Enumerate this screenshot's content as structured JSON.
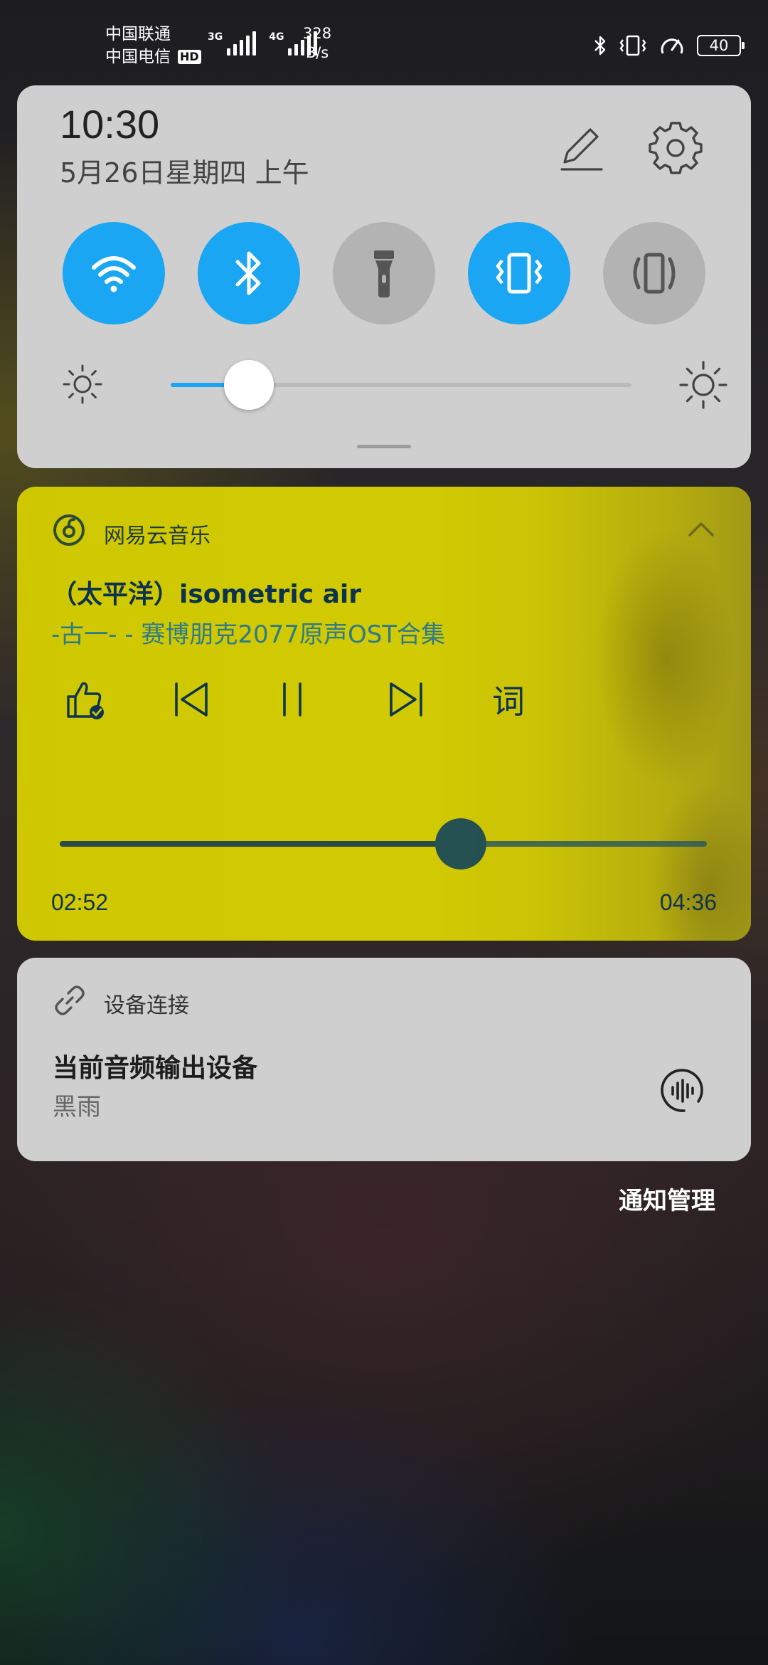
{
  "status_bar": {
    "carrier_1": "中国联通",
    "carrier_2": "中国电信",
    "hd_badge": "HD",
    "sim1_network": "3G",
    "sim2_network": "4G",
    "net_speed_value": "328",
    "net_speed_unit": "B/s",
    "battery_level": "40",
    "icons": [
      "bluetooth-icon",
      "vibrate-icon",
      "speed-gauge-icon",
      "battery-icon"
    ]
  },
  "quick_settings": {
    "time": "10:30",
    "date": "5月26日星期四 上午",
    "tiles": [
      {
        "name": "wifi",
        "state": "on"
      },
      {
        "name": "bluetooth",
        "state": "on"
      },
      {
        "name": "flashlight",
        "state": "off"
      },
      {
        "name": "vibrate",
        "state": "on"
      },
      {
        "name": "auto-rotate",
        "state": "off"
      }
    ],
    "brightness_level": 0.17,
    "accent_color": "#1aa6f2"
  },
  "music": {
    "app_name": "网易云音乐",
    "title": "（太平洋）isometric air",
    "subtitle": "-古一- - 赛博朋克2077原声OST合集",
    "lyric_button": "词",
    "current_time": "02:52",
    "total_time": "04:36",
    "progress": 0.62,
    "background_color": "#d2ca02"
  },
  "device": {
    "title": "设备连接",
    "label": "当前音频输出设备",
    "value": "黑雨"
  },
  "notification_manage": "通知管理"
}
